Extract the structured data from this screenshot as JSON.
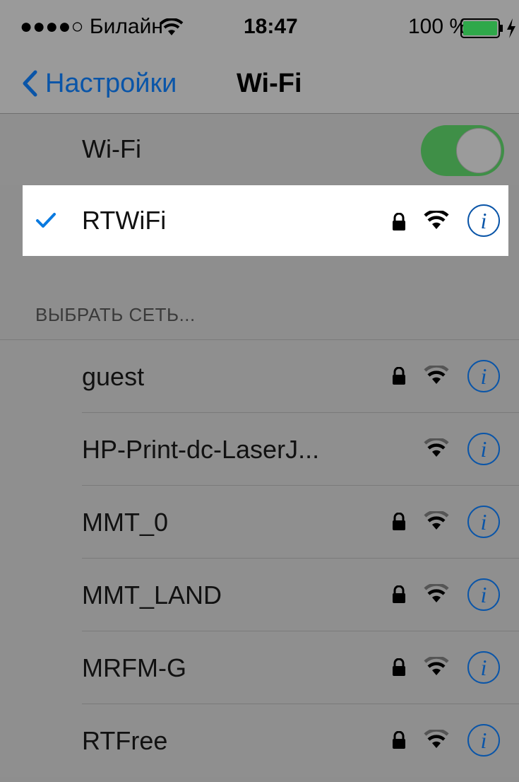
{
  "status_bar": {
    "signal_carrier": "●●●●○ Билайн",
    "time": "18:47",
    "battery_percent": "100 %",
    "icons": [
      "wifi-icon",
      "battery-icon",
      "charging-bolt-icon"
    ]
  },
  "nav": {
    "back_label": "Настройки",
    "title": "Wi-Fi"
  },
  "wifi_toggle": {
    "label": "Wi-Fi",
    "on": true
  },
  "connected_network": {
    "name": "RTWiFi",
    "secured": true
  },
  "section_header": "ВЫБРАТЬ СЕТЬ...",
  "networks": [
    {
      "name": "guest",
      "secured": true
    },
    {
      "name": "HP-Print-dc-LaserJ...",
      "secured": false
    },
    {
      "name": "MMT_0",
      "secured": true
    },
    {
      "name": "MMT_LAND",
      "secured": true
    },
    {
      "name": "MRFM-G",
      "secured": true
    },
    {
      "name": "RTFree",
      "secured": true
    }
  ],
  "colors": {
    "accent": "#0a55a8",
    "toggle_on": "#3f8f47"
  }
}
